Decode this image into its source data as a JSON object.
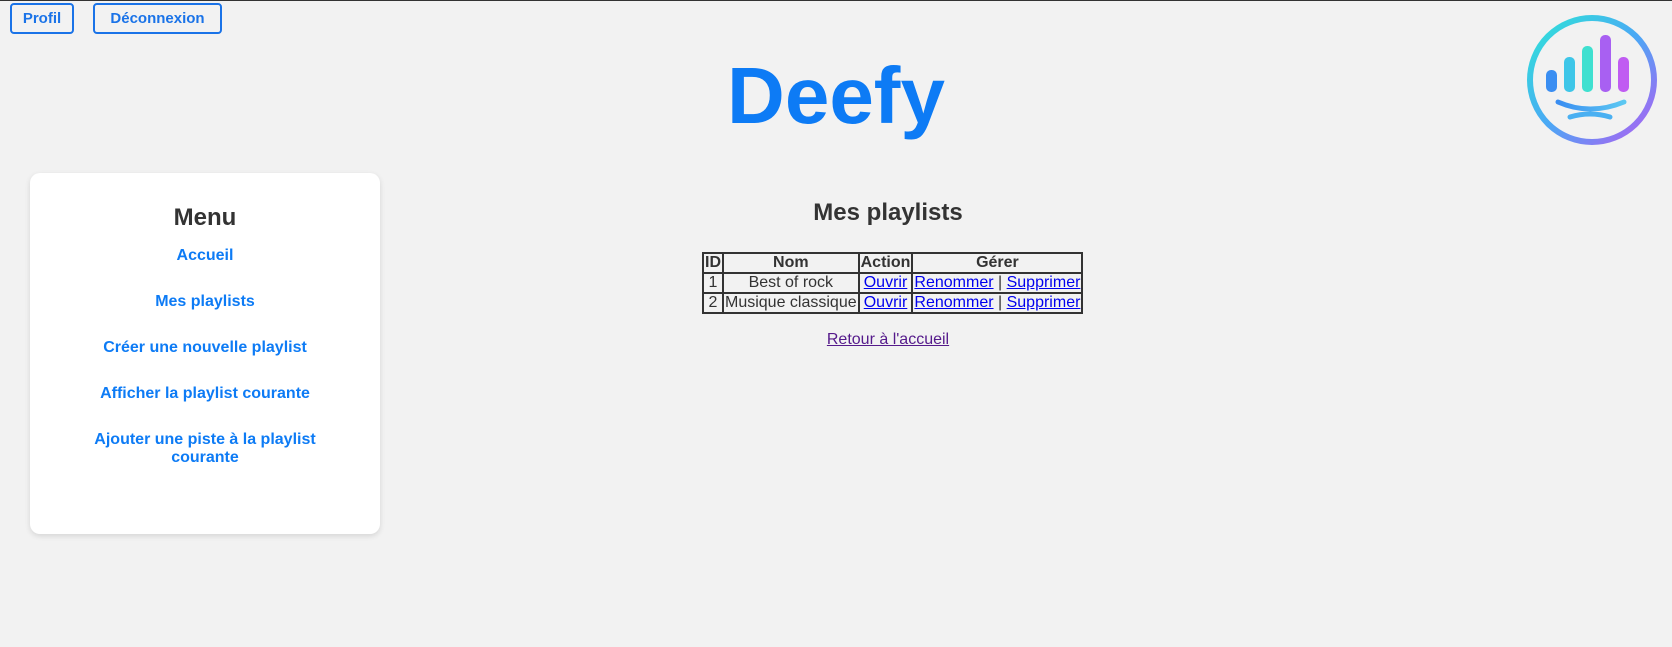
{
  "topbar": {
    "profile_label": "Profil",
    "logout_label": "Déconnexion"
  },
  "site": {
    "title": "Deefy",
    "logo_icon": "equalizer-smile-logo-icon",
    "accent_color": "#0d7bf5"
  },
  "menu": {
    "title": "Menu",
    "items": [
      {
        "label": "Accueil"
      },
      {
        "label": "Mes playlists"
      },
      {
        "label": "Créer une nouvelle playlist"
      },
      {
        "label": "Afficher la playlist courante"
      },
      {
        "label": "Ajouter une piste à la playlist courante"
      }
    ]
  },
  "main": {
    "title": "Mes playlists",
    "table": {
      "headers": [
        "ID",
        "Nom",
        "Action",
        "Gérer"
      ],
      "rows": [
        {
          "id": "1",
          "name": "Best of rock",
          "action": "Ouvrir",
          "rename": "Renommer",
          "separator": "|",
          "delete": "Supprimer"
        },
        {
          "id": "2",
          "name": "Musique classique",
          "action": "Ouvrir",
          "rename": "Renommer",
          "separator": "|",
          "delete": "Supprimer"
        }
      ]
    },
    "back_link": "Retour à l'accueil"
  }
}
